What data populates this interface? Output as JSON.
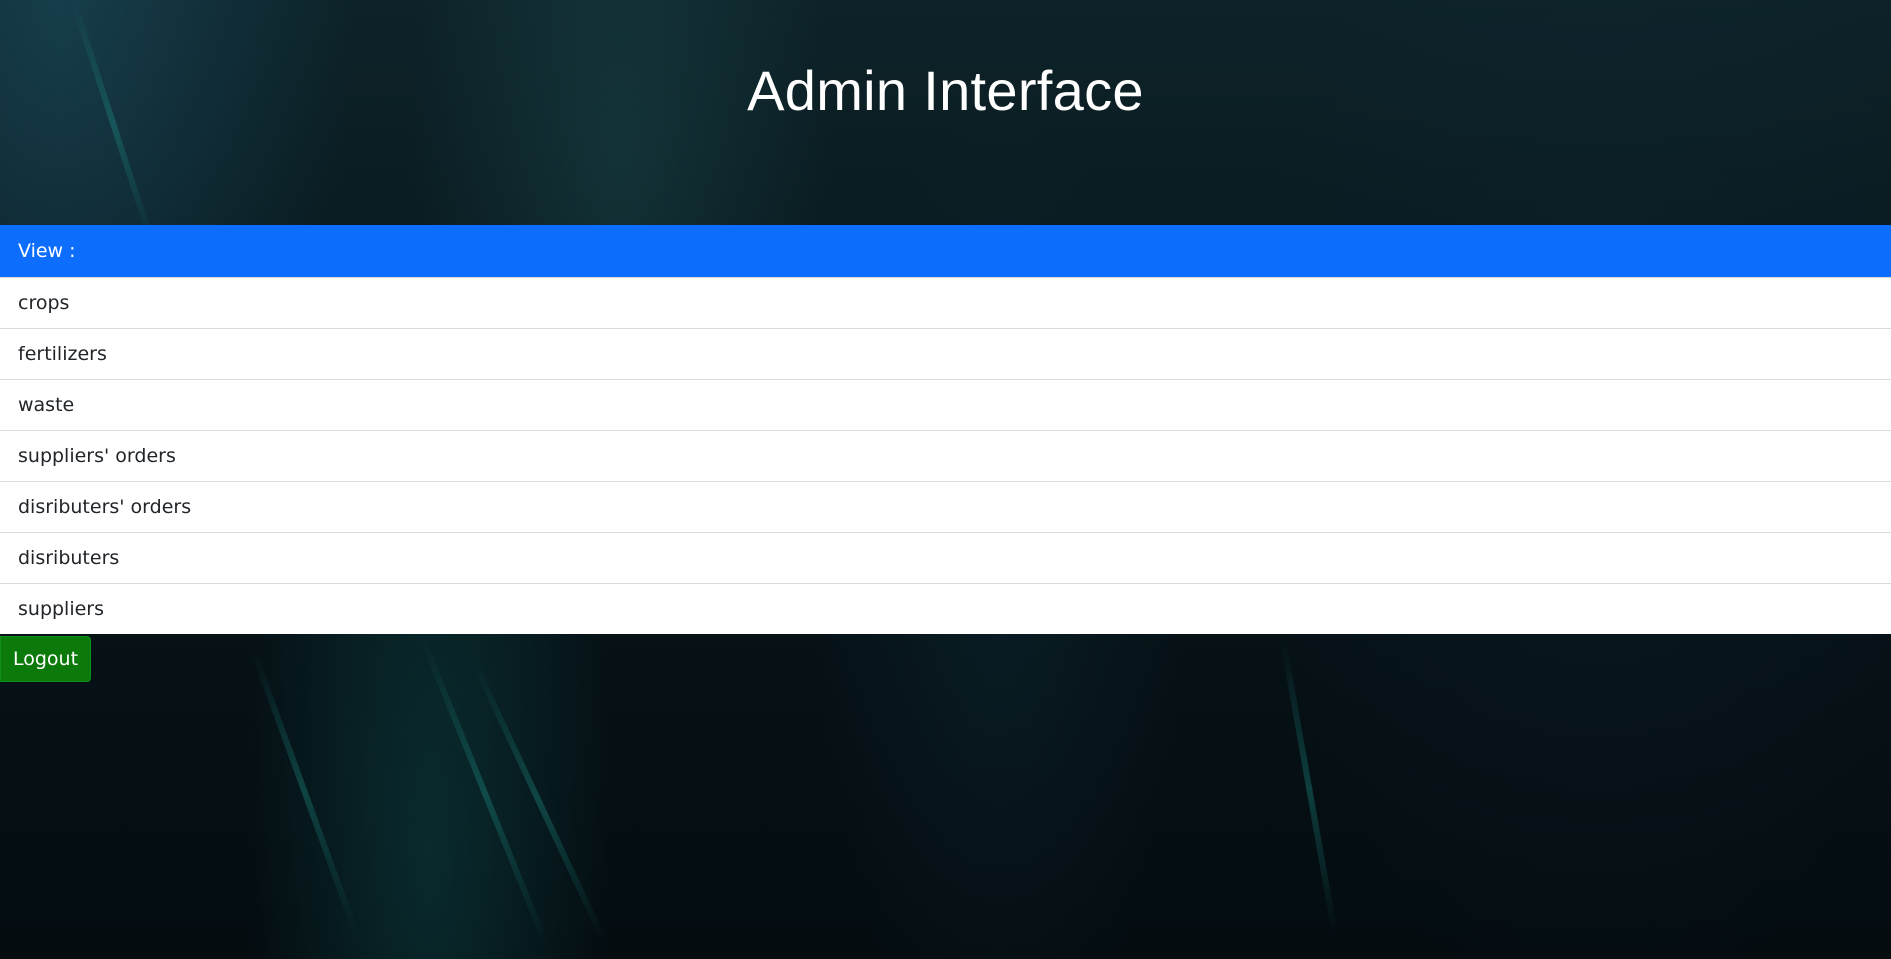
{
  "page": {
    "title": "Admin Interface"
  },
  "view_menu": {
    "header": "View :",
    "items": [
      "crops",
      "fertilizers",
      "waste",
      "suppliers' orders",
      "disributers' orders",
      "disributers",
      "suppliers"
    ]
  },
  "actions": {
    "logout_label": "Logout"
  },
  "colors": {
    "header_accent": "#0d6efd",
    "logout": "#0b7a0b",
    "background": "#06131a"
  }
}
